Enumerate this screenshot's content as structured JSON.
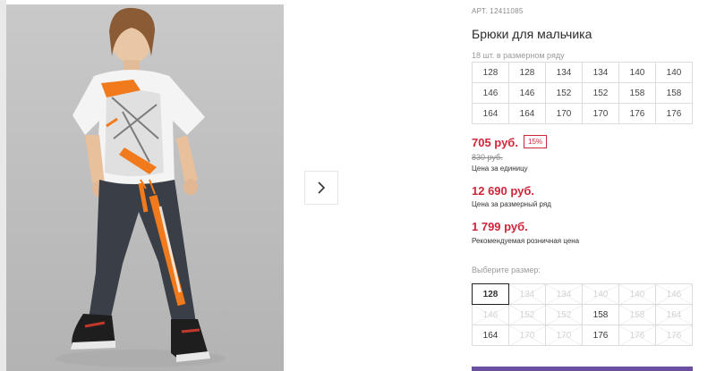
{
  "product": {
    "article_label": "АРТ.",
    "article": "12411085",
    "title": "Брюки для мальчика",
    "row_note": "18 шт. в размерном ряду",
    "size_row": [
      [
        "128",
        "128",
        "134",
        "134",
        "140",
        "140"
      ],
      [
        "146",
        "146",
        "152",
        "152",
        "158",
        "158"
      ],
      [
        "164",
        "164",
        "170",
        "170",
        "176",
        "176"
      ]
    ]
  },
  "pricing": {
    "price": "705 руб.",
    "discount": "15%",
    "old_price": "830 руб.",
    "unit_label": "Цена за единицу",
    "row_price": "12 690 руб.",
    "row_label": "Цена за размерный ряд",
    "rrp": "1 799 руб.",
    "rrp_label": "Рекомендуемая розничная цена"
  },
  "size_picker": {
    "label": "Выберите размер:",
    "rows": [
      [
        {
          "v": "128",
          "s": "selected"
        },
        {
          "v": "134",
          "s": "na"
        },
        {
          "v": "134",
          "s": "na"
        },
        {
          "v": "140",
          "s": "na"
        },
        {
          "v": "140",
          "s": "na"
        },
        {
          "v": "146",
          "s": "na"
        }
      ],
      [
        {
          "v": "146",
          "s": "na"
        },
        {
          "v": "152",
          "s": "na"
        },
        {
          "v": "152",
          "s": "na"
        },
        {
          "v": "158",
          "s": "available"
        },
        {
          "v": "158",
          "s": "na"
        },
        {
          "v": "164",
          "s": "na"
        }
      ],
      [
        {
          "v": "164",
          "s": "available"
        },
        {
          "v": "170",
          "s": "na"
        },
        {
          "v": "170",
          "s": "na"
        },
        {
          "v": "176",
          "s": "available"
        },
        {
          "v": "176",
          "s": "na"
        },
        {
          "v": "176",
          "s": "na"
        }
      ]
    ]
  },
  "colors": {
    "price_red": "#d0263a",
    "accent_orange": "#f07a1c",
    "cart_purple": "#6b4fa1"
  },
  "icons": {
    "next": "chevron-right-icon"
  }
}
